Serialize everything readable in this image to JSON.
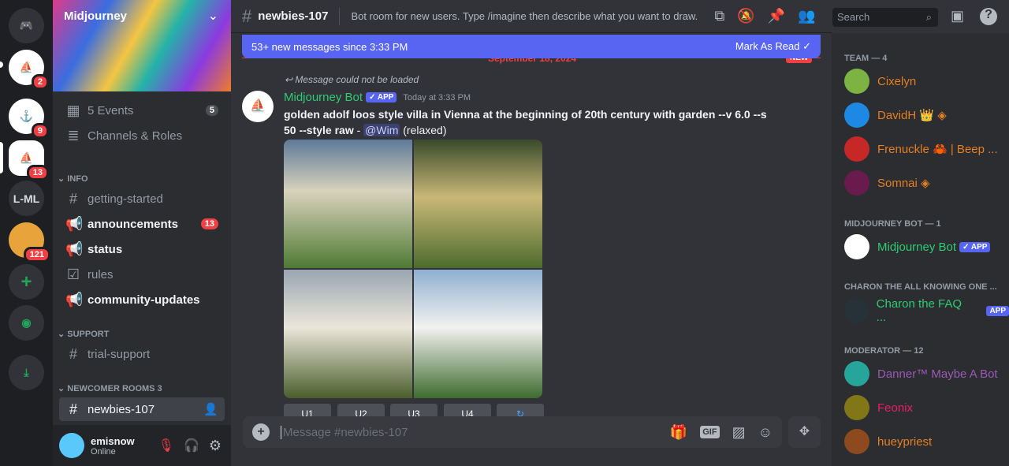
{
  "servers": [
    {
      "label": "",
      "badge": "2"
    },
    {
      "label": "",
      "badge": "9"
    },
    {
      "label": "",
      "badge": "13"
    },
    {
      "label": "L-ML",
      "badge": ""
    },
    {
      "label": "",
      "badge": "121"
    }
  ],
  "server": {
    "name": "Midjourney"
  },
  "channels": {
    "events": {
      "label": "5 Events",
      "count": "5"
    },
    "roles": {
      "label": "Channels & Roles"
    },
    "cat_info": "INFO",
    "cat_support": "SUPPORT",
    "cat_newcomer": "NEWCOMER ROOMS 3",
    "items": [
      {
        "label": "getting-started"
      },
      {
        "label": "announcements",
        "badge": "13"
      },
      {
        "label": "status"
      },
      {
        "label": "rules"
      },
      {
        "label": "community-updates"
      },
      {
        "label": "trial-support"
      },
      {
        "label": "newbies-107"
      }
    ]
  },
  "user": {
    "name": "emisnow",
    "status": "Online"
  },
  "header": {
    "channel": "newbies-107",
    "topic": "Bot room for new users. Type /imagine then describe what you want to draw. ...",
    "search_placeholder": "Search"
  },
  "banner": {
    "text": "53+ new messages since 3:33 PM",
    "mark": "Mark As Read"
  },
  "divider": {
    "date": "September 18, 2024",
    "new": "NEW"
  },
  "message": {
    "reply": "Message could not be loaded",
    "author": "Midjourney Bot",
    "app": "✓ APP",
    "time": "Today at 3:33 PM",
    "prompt": "golden adolf loos style villa in Vienna at the beginning of 20th century with garden --v 6.0 --s 50 --style raw",
    "dash": " - ",
    "mention": "@Wim",
    "mode": " (relaxed)",
    "buttons": [
      "U1",
      "U2",
      "U3",
      "U4",
      "↻"
    ]
  },
  "composer": {
    "placeholder": "Message #newbies-107"
  },
  "members": {
    "groups": [
      {
        "title": "TEAM — 4",
        "items": [
          {
            "name": "Cixelyn",
            "color": "#e67e22"
          },
          {
            "name": "DavidH 👑 ◈",
            "color": "#e67e22"
          },
          {
            "name": "Frenuckle 🦀 | Beep ...",
            "color": "#e67e22"
          },
          {
            "name": "Somnai ◈",
            "color": "#e67e22"
          }
        ]
      },
      {
        "title": "MIDJOURNEY BOT — 1",
        "items": [
          {
            "name": "Midjourney Bot",
            "color": "#2ecc71",
            "app": "✓ APP"
          }
        ]
      },
      {
        "title": "CHARON THE ALL KNOWING ONE ...",
        "items": [
          {
            "name": "Charon the FAQ ...",
            "color": "#2ecc71",
            "app": "APP"
          }
        ]
      },
      {
        "title": "MODERATOR — 12",
        "items": [
          {
            "name": "Danner™ Maybe A Bot",
            "color": "#9b59b6"
          },
          {
            "name": "Feonix",
            "color": "#e91e63"
          },
          {
            "name": "hueypriest",
            "color": "#e67e22"
          }
        ]
      }
    ]
  }
}
